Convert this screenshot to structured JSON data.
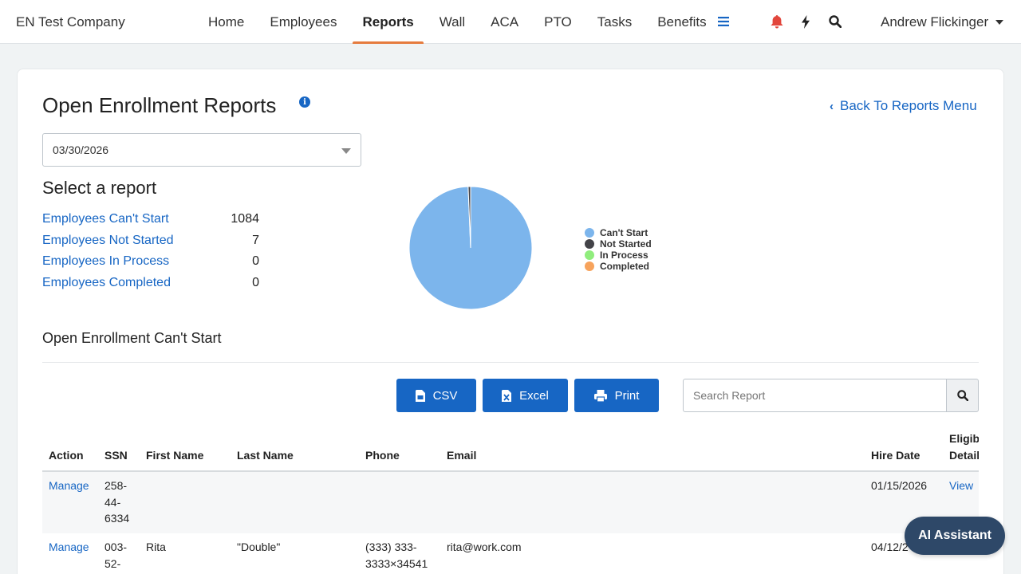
{
  "header": {
    "company": "EN Test Company",
    "nav": [
      "Home",
      "Employees",
      "Reports",
      "Wall",
      "ACA",
      "PTO",
      "Tasks",
      "Benefits"
    ],
    "active_nav": "Reports",
    "user": "Andrew Flickinger"
  },
  "page": {
    "title": "Open Enrollment Reports",
    "back_link": "Back To Reports Menu",
    "date_value": "03/30/2026",
    "select_title": "Select a report",
    "reports": [
      {
        "label": "Employees Can't Start",
        "count": "1084"
      },
      {
        "label": "Employees Not Started",
        "count": "7"
      },
      {
        "label": "Employees In Process",
        "count": "0"
      },
      {
        "label": "Employees Completed",
        "count": "0"
      }
    ],
    "section_title": "Open Enrollment Can't Start",
    "buttons": {
      "csv": "CSV",
      "excel": "Excel",
      "print": "Print"
    },
    "search_placeholder": "Search Report",
    "ai_assistant": "AI Assistant"
  },
  "chart_data": {
    "type": "pie",
    "categories": [
      "Can't Start",
      "Not Started",
      "In Process",
      "Completed"
    ],
    "values": [
      1084,
      7,
      0,
      0
    ],
    "colors": [
      "#7cb5ec",
      "#434348",
      "#90ed7d",
      "#f7a35c"
    ],
    "legend_position": "right"
  },
  "table": {
    "columns": {
      "action": "Action",
      "ssn": "SSN",
      "first_name": "First Name",
      "last_name": "Last Name",
      "phone": "Phone",
      "email": "Email",
      "hire_date": "Hire Date",
      "elig_1": "Eligib",
      "elig_2": "Detail"
    },
    "rows": [
      {
        "action": "Manage",
        "ssn": [
          "258-",
          "44-",
          "6334"
        ],
        "first_name": "",
        "last_name": "",
        "phone": [
          "",
          ""
        ],
        "email": "",
        "hire_date": "01/15/2026",
        "eligibility": "View"
      },
      {
        "action": "Manage",
        "ssn": [
          "003-",
          "52-",
          ""
        ],
        "first_name": "Rita",
        "last_name": "\"Double\"",
        "phone": [
          "(333) 333-",
          "3333×34541"
        ],
        "email": "rita@work.com",
        "hire_date": "04/12/2",
        "eligibility": ""
      }
    ]
  }
}
